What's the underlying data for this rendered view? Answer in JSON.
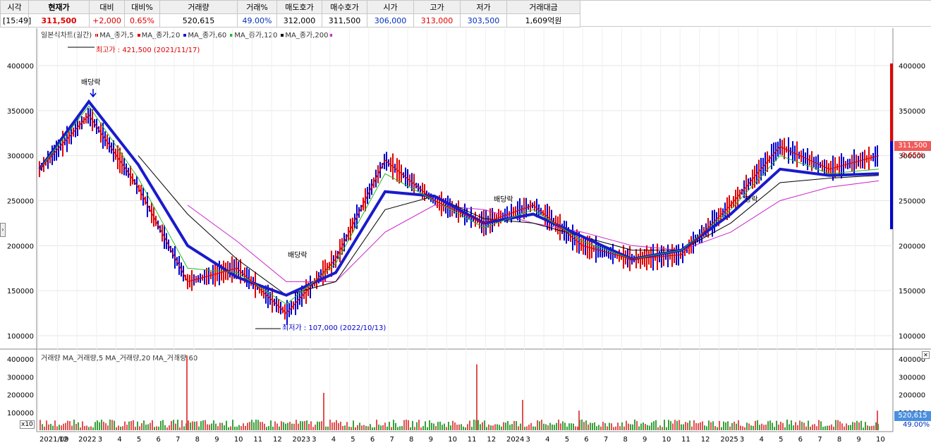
{
  "quote": {
    "headers": [
      "시각",
      "현재가",
      "대비",
      "대비%",
      "거래량",
      "거래%",
      "매도호가",
      "매수호가",
      "시가",
      "고가",
      "저가",
      "거래대금"
    ],
    "time": "[15:49]",
    "current": "311,500",
    "change": "+2,000",
    "change_pct": "0.65%",
    "volume": "520,615",
    "volume_pct": "49.00%",
    "ask": "312,000",
    "bid": "311,500",
    "open": "306,000",
    "high": "313,000",
    "low": "303,500",
    "turnover": "1,609억원"
  },
  "legend": {
    "title": "일본식차트(일간)",
    "ma5": "MA_종가,5",
    "ma20": "MA_종가,20",
    "ma60": "MA_종가,60",
    "ma120": "MA_종가,120",
    "ma200": "MA_종가,200"
  },
  "vol_legend": {
    "title": "거래량",
    "ma5": "MA_거래량,5",
    "ma20": "MA_거래량,20",
    "ma60": "MA_거래량,60"
  },
  "annotations": {
    "high": "최고가 : 421,500 (2021/11/17)",
    "low": "최저가 : 107,000 (2022/10/13)",
    "div1": "배당락",
    "div2": "배당락",
    "div3": "배당락",
    "div4": "당락"
  },
  "price_axis": [
    "400000",
    "350000",
    "300000",
    "250000",
    "200000",
    "150000",
    "100000"
  ],
  "vol_axis": [
    "400000",
    "300000",
    "200000",
    "100000"
  ],
  "x_labels": [
    "2021/09",
    "12",
    "2022",
    "3",
    "4",
    "5",
    "6",
    "7",
    "8",
    "9",
    "10",
    "11",
    "12",
    "2023",
    "3",
    "4",
    "5",
    "6",
    "7",
    "8",
    "9",
    "10",
    "11",
    "12",
    "2024",
    "3",
    "4",
    "5",
    "6",
    "7",
    "8",
    "9",
    "10",
    "11",
    "12",
    "2025",
    "3",
    "4",
    "5",
    "6",
    "7",
    "8",
    "9",
    "10"
  ],
  "badges": {
    "price": "311,500",
    "price_pct": "0.65%",
    "vol": "520,615",
    "vol_pct": "49.00%",
    "x10": "x10"
  },
  "colors": {
    "up": "#e00000",
    "down": "#0000cc",
    "ma5": "#e00000",
    "ma20": "#22bb22",
    "ma60": "#1a1acc",
    "ma120": "#000000",
    "ma200": "#cc22cc"
  },
  "chart_data": {
    "type": "line",
    "title": "일본식차트(일간)",
    "ylim": [
      90000,
      430000
    ],
    "x": [
      "2021/09",
      "2021/12",
      "2022/03",
      "2022/06",
      "2022/09",
      "2022/12",
      "2023/03",
      "2023/06",
      "2023/09",
      "2023/12",
      "2024/03",
      "2024/06",
      "2024/09",
      "2024/12",
      "2025/03",
      "2025/06",
      "2025/09",
      "2025/10"
    ],
    "series": [
      {
        "name": "MA_종가,5",
        "values": [
          285000,
          345000,
          265000,
          160000,
          175000,
          125000,
          185000,
          295000,
          250000,
          225000,
          245000,
          200000,
          185000,
          190000,
          245000,
          310000,
          285000,
          300000
        ]
      },
      {
        "name": "MA_종가,20",
        "values": [
          285000,
          355000,
          275000,
          175000,
          170000,
          135000,
          180000,
          280000,
          250000,
          220000,
          240000,
          205000,
          185000,
          195000,
          240000,
          300000,
          280000,
          285000
        ]
      },
      {
        "name": "MA_종가,60",
        "values": [
          285000,
          360000,
          290000,
          200000,
          165000,
          145000,
          170000,
          260000,
          255000,
          225000,
          235000,
          210000,
          185000,
          195000,
          235000,
          285000,
          278000,
          280000
        ]
      },
      {
        "name": "MA_종가,120",
        "values": [
          null,
          null,
          300000,
          235000,
          185000,
          145000,
          160000,
          240000,
          255000,
          230000,
          225000,
          210000,
          195000,
          195000,
          225000,
          270000,
          275000,
          278000
        ]
      },
      {
        "name": "MA_종가,200",
        "values": [
          null,
          null,
          null,
          245000,
          205000,
          160000,
          160000,
          215000,
          245000,
          240000,
          225000,
          215000,
          200000,
          195000,
          215000,
          250000,
          265000,
          272000
        ]
      }
    ]
  }
}
